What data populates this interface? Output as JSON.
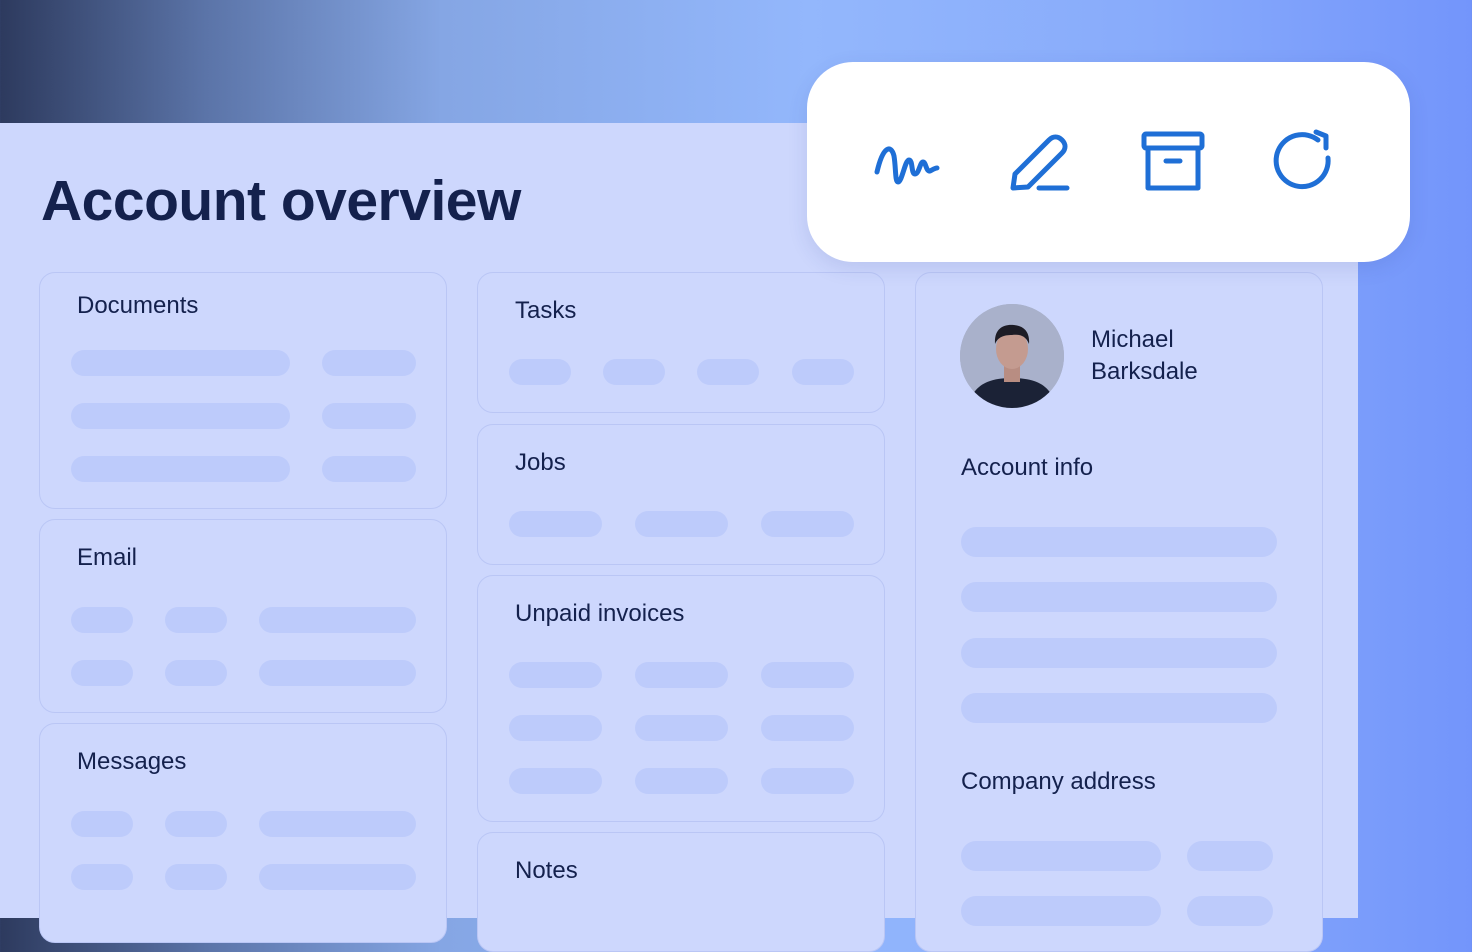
{
  "page": {
    "title": "Account overview"
  },
  "toolbar": {
    "tools": [
      {
        "icon": "signature-icon"
      },
      {
        "icon": "pencil-edit-icon"
      },
      {
        "icon": "archive-box-icon"
      },
      {
        "icon": "refresh-icon"
      }
    ],
    "icon_color": "#1f6fd6"
  },
  "cards": {
    "documents": {
      "title": "Documents"
    },
    "email": {
      "title": "Email"
    },
    "messages": {
      "title": "Messages"
    },
    "tasks": {
      "title": "Tasks"
    },
    "jobs": {
      "title": "Jobs"
    },
    "unpaid_invoices": {
      "title": "Unpaid invoices"
    },
    "notes": {
      "title": "Notes"
    }
  },
  "profile": {
    "first_name": "Michael",
    "last_name": "Barksdale",
    "account_info_title": "Account info",
    "company_address_title": "Company address"
  },
  "colors": {
    "panel_bg": "#cdd7fd",
    "placeholder_pill": "#bdcbfb",
    "text_dark": "#14214d"
  }
}
